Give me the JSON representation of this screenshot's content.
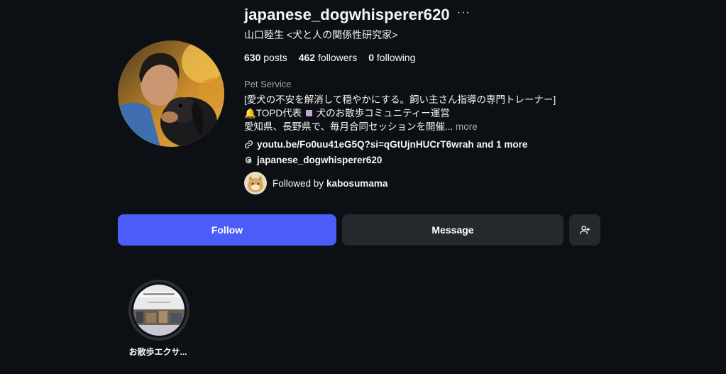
{
  "profile": {
    "username": "japanese_dogwhisperer620",
    "more_icon": "···",
    "full_name": "山口睦生 <犬と人の関係性研究家>",
    "stats": {
      "posts_count": "630",
      "posts_label": "posts",
      "followers_count": "462",
      "followers_label": "followers",
      "following_count": "0",
      "following_label": "following"
    },
    "category": "Pet Service",
    "bio": {
      "line1": "[愛犬の不安を解消して穏やかにする。飼い主さん指導の専門トレーナー]",
      "line2_icon": "🔔",
      "line2_a": "TOPD代表",
      "line2_b": "犬のお散歩コミュニティー運営",
      "line3": "愛知県、長野県で、毎月合同セッションを開催...",
      "more": "more"
    },
    "link": {
      "icon": "link-icon",
      "text": "youtu.be/Fo0uu41eG5Q?si=qGtUjnHUCrT6wrah and 1 more"
    },
    "threads": {
      "icon": "threads-icon",
      "text": "japanese_dogwhisperer620"
    },
    "followed_by": {
      "prefix": "Followed by",
      "name": "kabosumama"
    }
  },
  "actions": {
    "follow": "Follow",
    "message": "Message",
    "add_user_icon": "add-user-icon"
  },
  "highlights": [
    {
      "label": "お散歩エクサ..."
    }
  ],
  "colors": {
    "background": "#0c1014",
    "follow_button": "#4a5df9",
    "secondary_button": "#25292e",
    "muted_text": "#a8a8a8"
  }
}
